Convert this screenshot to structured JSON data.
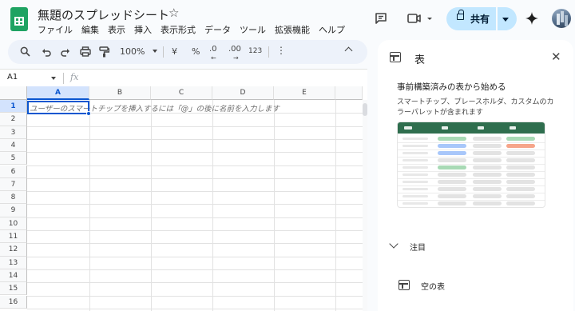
{
  "header": {
    "doc_title": "無題のスプレッドシート",
    "star_glyph": "☆",
    "menu": [
      "ファイル",
      "編集",
      "表示",
      "挿入",
      "表示形式",
      "データ",
      "ツール",
      "拡張機能",
      "ヘルプ"
    ],
    "share_label": "共有"
  },
  "toolbar": {
    "zoom": "100%",
    "currency": "¥",
    "percent": "%",
    "dec_decrease": ".0",
    "dec_increase": ".00",
    "more_formats": "123"
  },
  "formula_bar": {
    "name_box": "A1",
    "fx": "fx"
  },
  "grid": {
    "columns": [
      "A",
      "B",
      "C",
      "D",
      "E"
    ],
    "rows": [
      "1",
      "2",
      "3",
      "4",
      "5",
      "6",
      "7",
      "8",
      "9",
      "10",
      "11",
      "12",
      "13",
      "14",
      "15",
      "16"
    ],
    "selected_cell": "A1",
    "hint_text": "ユーザーのスマートチップを挿入するには「@」の後に名前を入力します"
  },
  "side_panel": {
    "title": "表",
    "heading": "事前構築済みの表から始める",
    "description": "スマートチップ、プレースホルダ、カスタムのカラーパレットが含まれます",
    "accordion_label": "注目",
    "empty_table_label": "空の表",
    "preview_colors": {
      "header": "#2f6e4e",
      "green": "#a8dab5",
      "blue": "#a8c7fa",
      "orange": "#f6a58a",
      "gray": "#e3e3e3"
    }
  },
  "colors": {
    "selection": "#0b57d0",
    "share_bg": "#c2e7ff",
    "sheets_green": "#1ea362"
  }
}
